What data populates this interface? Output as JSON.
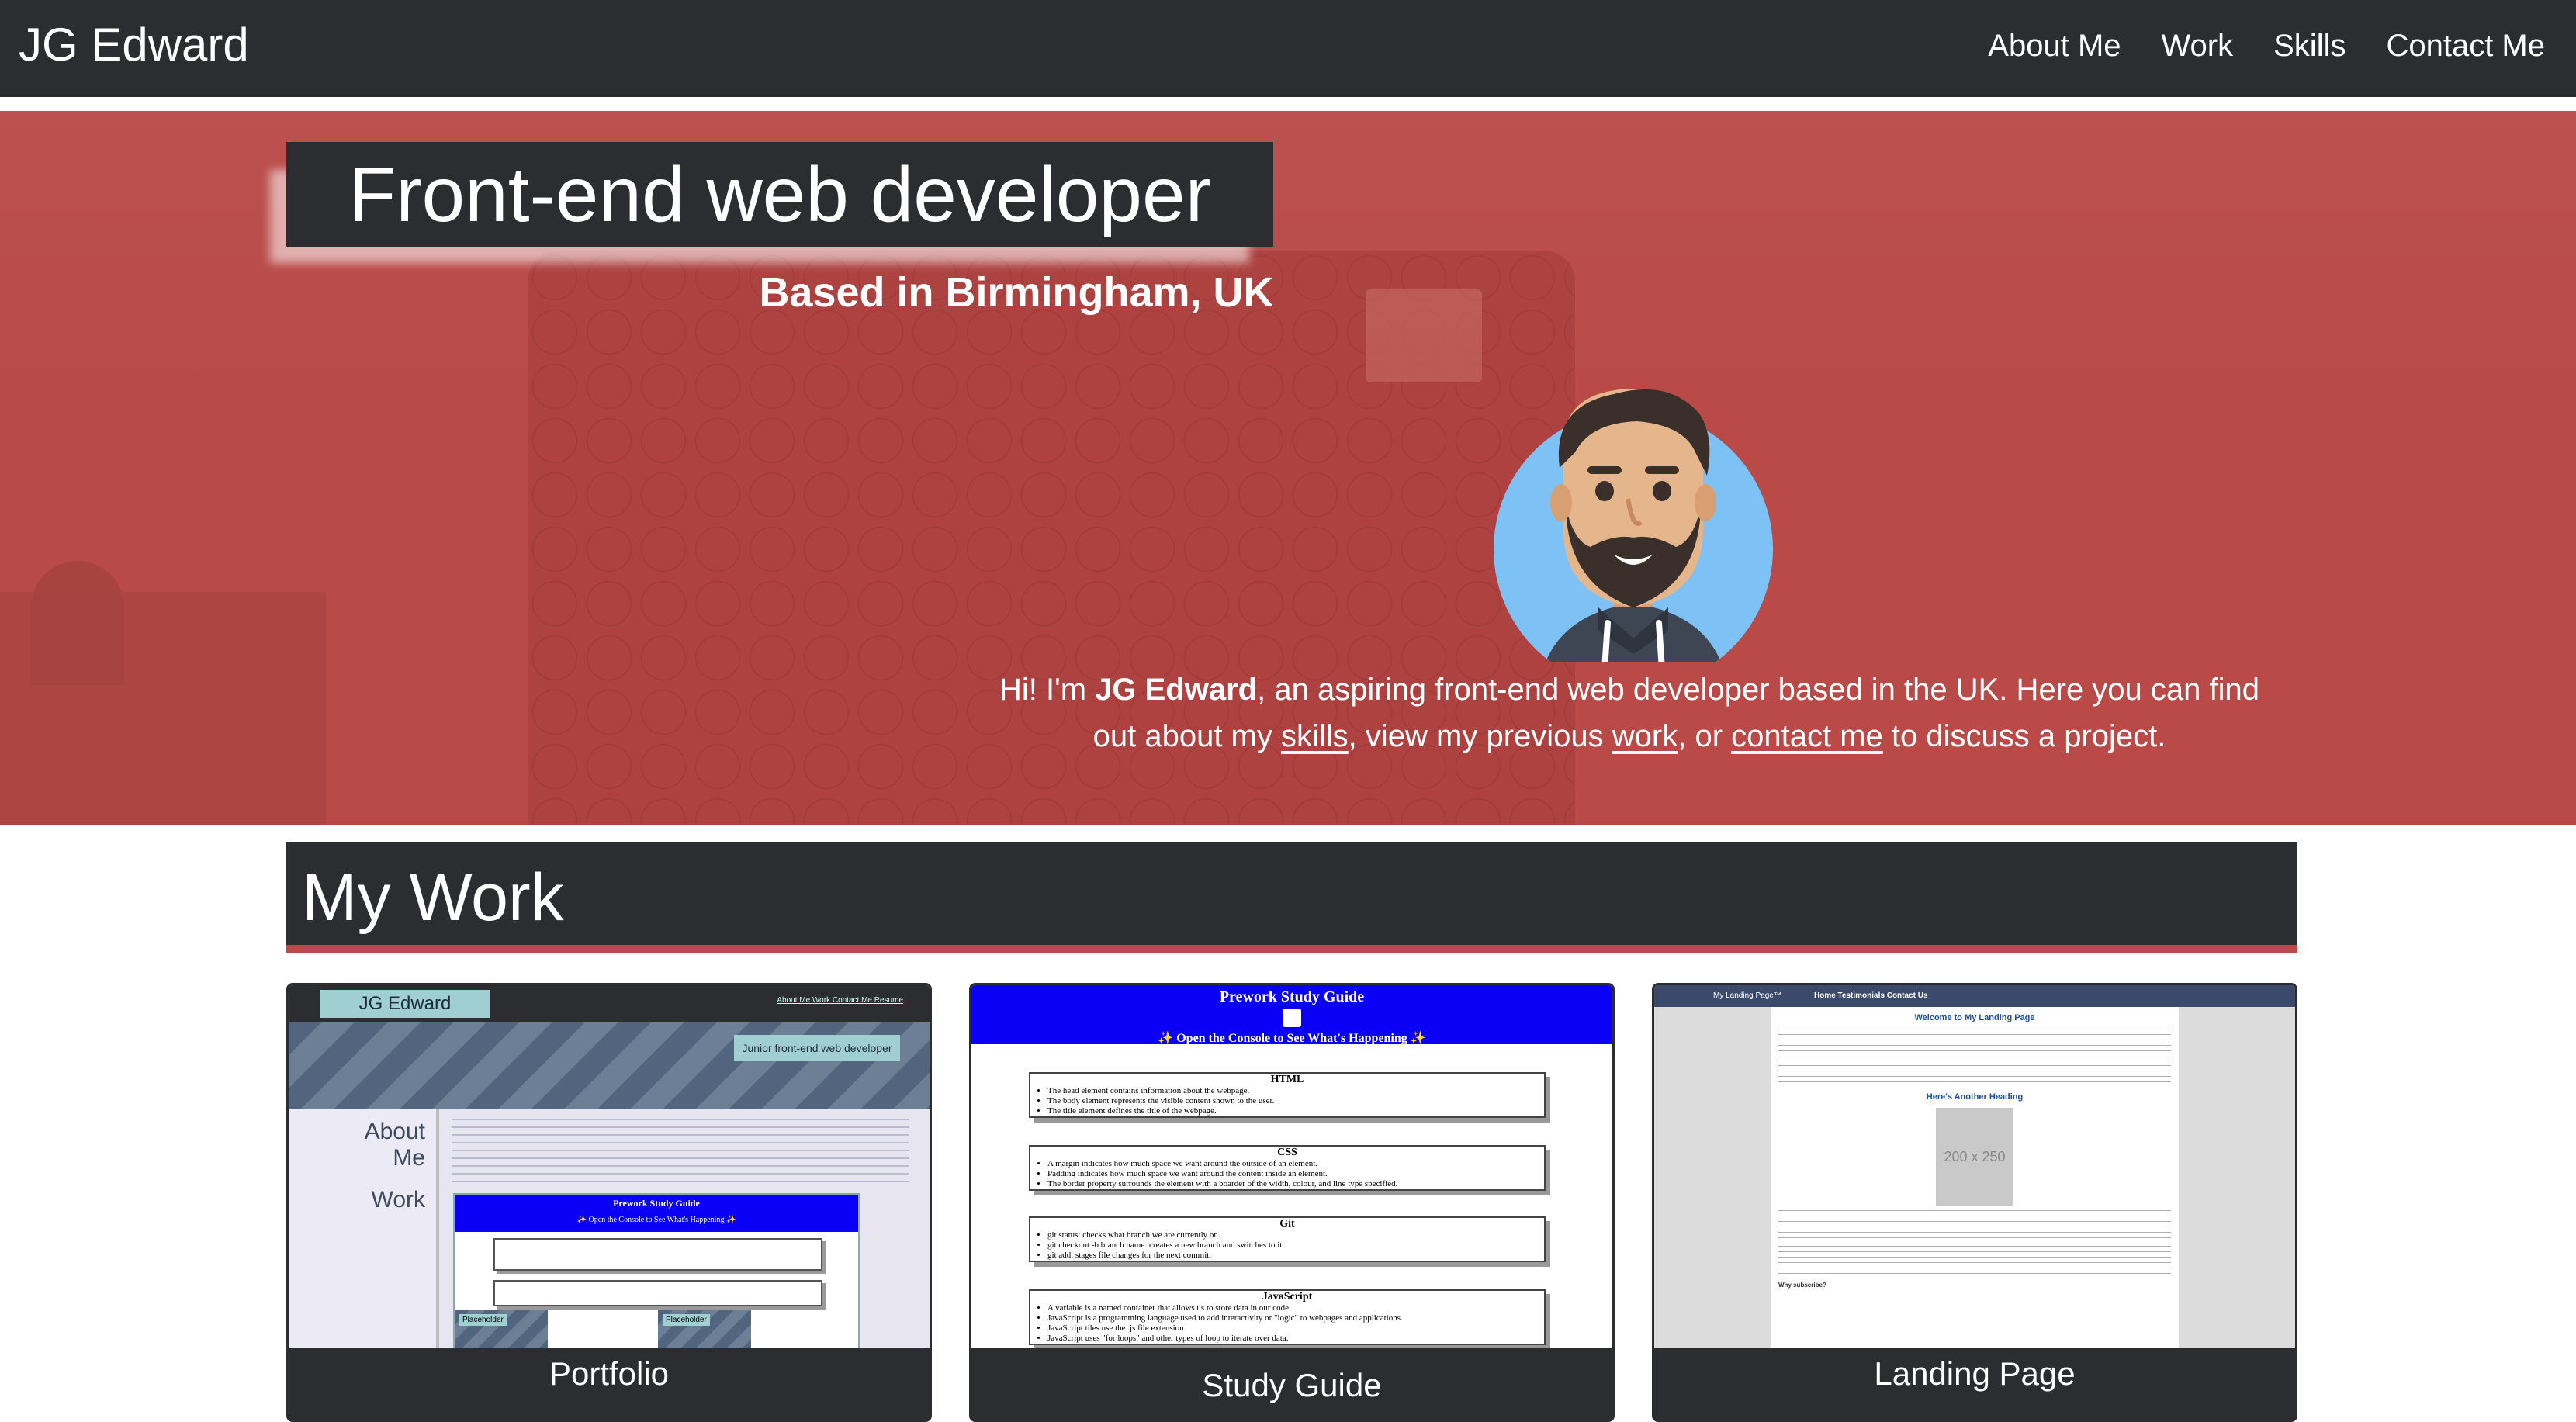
{
  "nav": {
    "brand": "JG Edward",
    "links": [
      "About Me",
      "Work",
      "Skills",
      "Contact Me"
    ]
  },
  "hero": {
    "headline": "Front-end web developer",
    "subheadline": "Based in Birmingham, UK",
    "intro": {
      "part1": "Hi! I'm ",
      "name": "JG Edward",
      "part2": ", an aspiring front-end web developer based in the UK. Here you can find out about my ",
      "skills_link": "skills",
      "part3": ", view my previous ",
      "work_link": "work",
      "part4": ", or ",
      "contact_link": "contact me",
      "part5": " to discuss a project."
    }
  },
  "work": {
    "title": "My Work",
    "cards": [
      {
        "title": "Portfolio",
        "thumb": {
          "brand": "JG Edward",
          "links": "About Me  Work  Contact Me  Resume",
          "tag": "Junior front-end web developer",
          "about": "About Me",
          "work": "Work",
          "mini_title": "Prework Study Guide",
          "mini_sub": "✨ Open the Console to See What's Happening ✨",
          "placeholder": "Placeholder"
        }
      },
      {
        "title": "Study Guide",
        "thumb": {
          "title": "Prework Study Guide",
          "subtitle": "✨ Open the Console to See What's Happening ✨",
          "sections": [
            {
              "heading": "HTML",
              "items": [
                "The head element contains information about the webpage.",
                "The body element represents the visible content shown to the user.",
                "The title element defines the title of the webpage."
              ]
            },
            {
              "heading": "CSS",
              "items": [
                "A margin indicates how much space we want around the outside of an element.",
                "Padding indicates how much space we want around the content inside an element.",
                "The border property surrounds the element with a boarder of the width, colour, and line type specified."
              ]
            },
            {
              "heading": "Git",
              "items": [
                "git status: checks what branch we are currently on.",
                "git checkout -b branch name: creates a new branch and switches to it.",
                "git add: stages file changes for the next commit."
              ]
            },
            {
              "heading": "JavaScript",
              "items": [
                "A variable is a named container that allows us to store data in our code.",
                "JavaScript is a programming language used to add interactivity or \"logic\" to webpages and applications.",
                "JavaScript tiles use the .js file extension.",
                "JavaScript uses \"for loops\" and other types of loop to iterate over data."
              ]
            }
          ]
        }
      },
      {
        "title": "Landing Page",
        "thumb": {
          "brand": "My Landing Page™",
          "links": "Home  Testimonials  Contact Us",
          "heading1": "Welcome to My Landing Page",
          "heading2": "Here's Another Heading",
          "img_label": "200 x 250",
          "footer_label": "Why subscribe?"
        }
      }
    ]
  },
  "colors": {
    "nav_bg": "#2c2d31",
    "hero_bg": "#b94a48",
    "accent": "#b94a48",
    "guide_blue": "#0a00f5"
  }
}
